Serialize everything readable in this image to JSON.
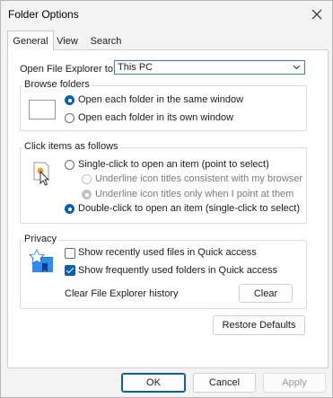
{
  "window": {
    "title": "Folder Options"
  },
  "tabs": [
    {
      "label": "General",
      "active": true
    },
    {
      "label": "View",
      "active": false
    },
    {
      "label": "Search",
      "active": false
    }
  ],
  "open_with": {
    "label": "Open File Explorer to:",
    "value": "This PC"
  },
  "browse_folders": {
    "legend": "Browse folders",
    "options": [
      {
        "label": "Open each folder in the same window",
        "selected": true
      },
      {
        "label": "Open each folder in its own window",
        "selected": false
      }
    ]
  },
  "click_items": {
    "legend": "Click items as follows",
    "single": "Single-click to open an item (point to select)",
    "sub_options": [
      {
        "label": "Underline icon titles consistent with my browser",
        "selected": false
      },
      {
        "label": "Underline icon titles only when I point at them",
        "selected": true
      }
    ],
    "double": "Double-click to open an item (single-click to select)"
  },
  "privacy": {
    "legend": "Privacy",
    "options": [
      {
        "label": "Show recently used files in Quick access",
        "checked": false
      },
      {
        "label": "Show frequently used folders in Quick access",
        "checked": true
      }
    ],
    "clear_label": "Clear File Explorer history",
    "clear_button": "Clear"
  },
  "restore_button": "Restore Defaults",
  "footer": {
    "ok": "OK",
    "cancel": "Cancel",
    "apply": "Apply"
  },
  "colors": {
    "accent": "#0b5fb3"
  }
}
